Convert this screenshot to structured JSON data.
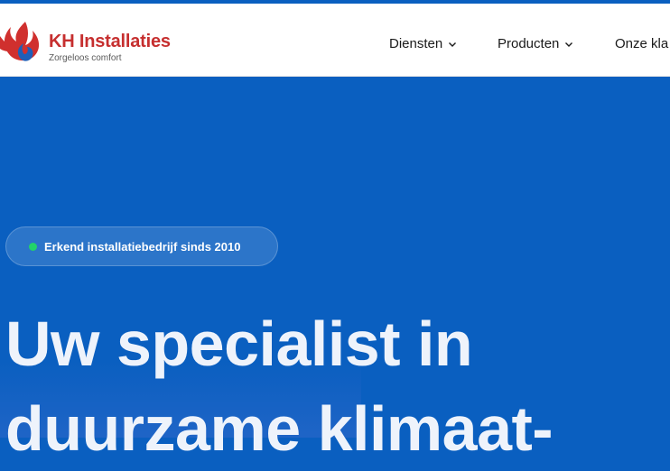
{
  "brand": {
    "name": "KH Installaties",
    "tagline": "Zorgeloos comfort"
  },
  "nav": {
    "items": [
      {
        "label": "Diensten",
        "has_dropdown": true
      },
      {
        "label": "Producten",
        "has_dropdown": true
      },
      {
        "label": "Onze kla",
        "has_dropdown": false
      }
    ]
  },
  "hero": {
    "badge": "Erkend installatiebedrijf sinds 2010",
    "title_line1": "Uw specialist in",
    "title_line2": "duurzame klimaat-"
  },
  "colors": {
    "header_bg": "#ffffff",
    "hero_bg": "#0a5fc0",
    "brand_red": "#c62f2f",
    "badge_dot": "#22d36a"
  },
  "icons": [
    "logo-flame-icon",
    "chevron-down-icon",
    "status-dot-icon"
  ]
}
